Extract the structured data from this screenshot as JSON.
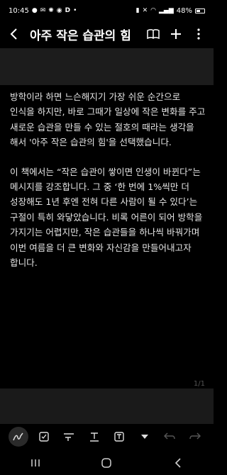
{
  "status_bar": {
    "time": "10:45",
    "battery_percent": "48%",
    "icons": [
      "chat-icon",
      "email-icon",
      "sync-icon",
      "notification-icon",
      "d-icon",
      "dot-icon",
      "silent-icon",
      "mute-icon",
      "wifi-icon",
      "signal-icon",
      "battery-icon"
    ],
    "d_label": "D"
  },
  "app_bar": {
    "title": "아주 작은 습관의 힘"
  },
  "content": {
    "paragraphs": [
      "방학이라 하면 느슨해지기 가장 쉬운 순간으로 인식을 하지만, 바로 그때가 일상에 작은 변화를 주고 새로운 습관을 만들 수 있는 절호의 때라는 생각을 해서 '아주 작은 습관의 힘'을 선택했습니다.",
      "이 책에서는 “작은 습관이 쌓이면 인생이 바뀐다”는 메시지를 강조합니다. 그 중 ‘한 번에 1%씩만 더 성장해도 1년 후엔 전혀 다른 사람이 될 수 있다’는 구절이 특히 와닿았습니다. 비록 어른이 되어 방학을 가지기는 어렵지만, 작은 습관들을 하나씩 바꿔가며 이번 여름을 더 큰 변화와 자신감을 만들어내고자 합니다."
    ]
  },
  "pager": "1/1"
}
